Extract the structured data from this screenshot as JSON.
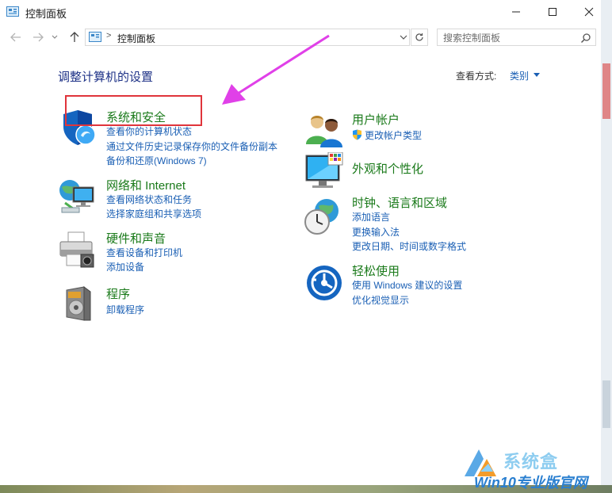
{
  "window": {
    "title": "控制面板"
  },
  "nav": {
    "address_text": "控制面板",
    "address_separator": ">",
    "search_placeholder": "搜索控制面板"
  },
  "content": {
    "heading": "调整计算机的设置",
    "view_by_label": "查看方式:",
    "view_by_value": "类别"
  },
  "categories": {
    "left": [
      {
        "title": "系统和安全",
        "icon": "shield-icon",
        "links": [
          "查看你的计算机状态",
          "通过文件历史记录保存你的文件备份副本",
          "备份和还原(Windows 7)"
        ]
      },
      {
        "title": "网络和 Internet",
        "icon": "network-icon",
        "links": [
          "查看网络状态和任务",
          "选择家庭组和共享选项"
        ]
      },
      {
        "title": "硬件和声音",
        "icon": "printer-icon",
        "links": [
          "查看设备和打印机",
          "添加设备"
        ]
      },
      {
        "title": "程序",
        "icon": "programs-icon",
        "links": [
          "卸载程序"
        ]
      }
    ],
    "right": [
      {
        "title": "用户帐户",
        "icon": "users-icon",
        "links": [
          "更改帐户类型"
        ]
      },
      {
        "title": "外观和个性化",
        "icon": "monitor-icon",
        "links": []
      },
      {
        "title": "时钟、语言和区域",
        "icon": "clock-globe-icon",
        "links": [
          "添加语言",
          "更换输入法",
          "更改日期、时间或数字格式"
        ]
      },
      {
        "title": "轻松使用",
        "icon": "ease-of-access-icon",
        "links": [
          "使用 Windows 建议的设置",
          "优化视觉显示"
        ]
      }
    ]
  },
  "watermark": {
    "top": "系统盒",
    "bottom": "Win10专业版官网"
  },
  "colors": {
    "category_title": "#1a7a1a",
    "link": "#1a5fb4",
    "heading": "#1e3287",
    "highlight_box": "#e0343b",
    "annotation_arrow": "#e040e8"
  }
}
